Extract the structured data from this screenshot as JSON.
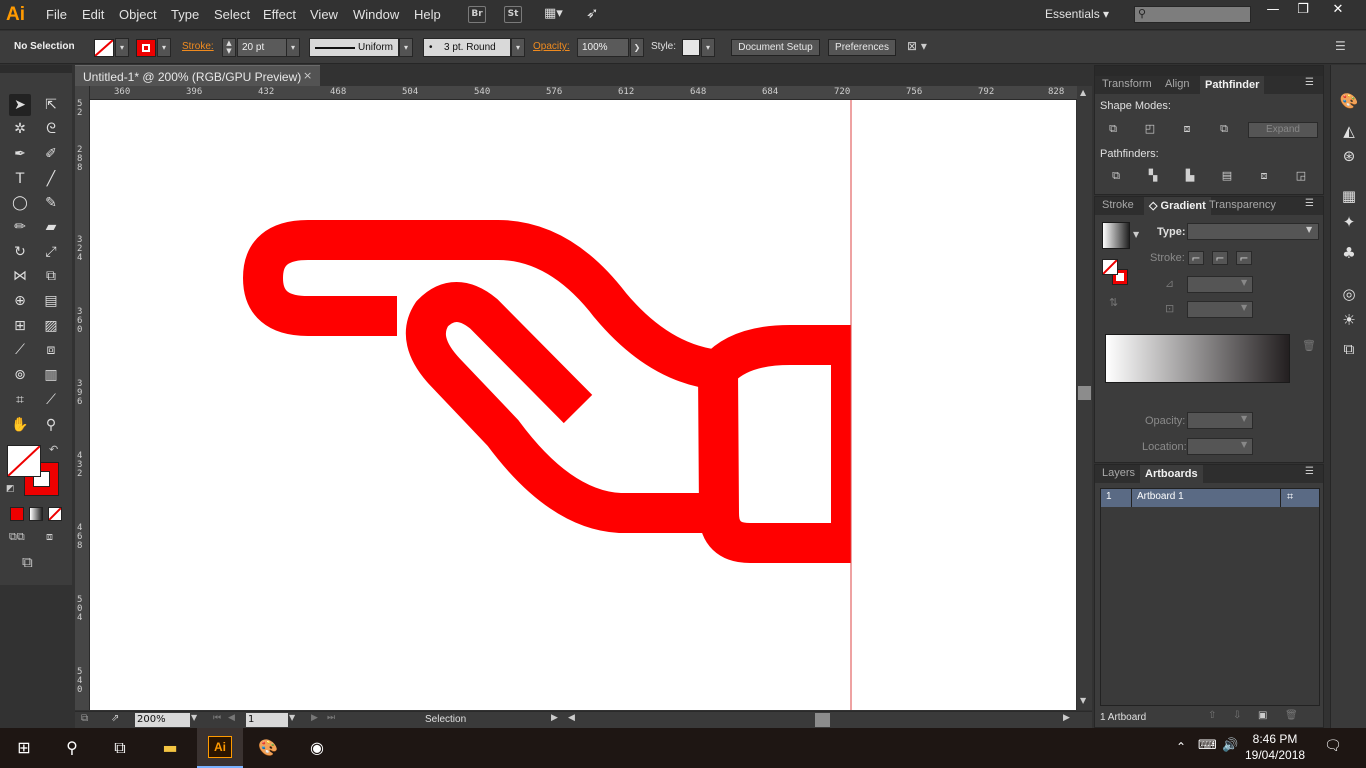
{
  "app": {
    "logo": "Ai",
    "menu": [
      "File",
      "Edit",
      "Object",
      "Type",
      "Select",
      "Effect",
      "View",
      "Window",
      "Help"
    ],
    "bridge_label": "Br",
    "stock_label": "St",
    "workspace": "Essentials",
    "window_controls": {
      "minimize": "—",
      "restore": "❐",
      "close": "✕"
    }
  },
  "control_bar": {
    "selection": "No Selection",
    "stroke_label": "Stroke:",
    "stroke_value": "20 pt",
    "profile_value": "Uniform",
    "brush_value": "3 pt. Round",
    "opacity_label": "Opacity:",
    "opacity_value": "100%",
    "style_label": "Style:",
    "document_setup": "Document Setup",
    "preferences": "Preferences"
  },
  "document": {
    "tab_title": "Untitled-1* @ 200% (RGB/GPU Preview)",
    "close": "×",
    "h_ruler_ticks": [
      "360",
      "396",
      "432",
      "468",
      "504",
      "540",
      "576",
      "612",
      "648",
      "684",
      "720",
      "756",
      "792",
      "828"
    ],
    "v_ruler_ticks": [
      "5\n2",
      "2\n8\n8",
      "3\n2\n4",
      "3\n6\n0",
      "3\n9\n6",
      "4\n3\n2",
      "4\n6\n8",
      "5\n0\n4",
      "5\n4\n0"
    ],
    "art_color": "#ff0000"
  },
  "status_bar": {
    "zoom": "200%",
    "artboard_number": "1",
    "status_text": "Selection"
  },
  "panels": {
    "top_tabs": [
      "Transform",
      "Align",
      "Pathfinder"
    ],
    "shape_modes_label": "Shape Modes:",
    "expand_label": "Expand",
    "pathfinders_label": "Pathfinders:",
    "mid_tabs": [
      "Stroke",
      "Gradient",
      "Transparency"
    ],
    "type_label": "Type:",
    "stroke_label": "Stroke:",
    "opacity_label": "Opacity:",
    "location_label": "Location:",
    "bottom_tabs": [
      "Layers",
      "Artboards"
    ],
    "artboard_rows": [
      {
        "index": "1",
        "name": "Artboard 1"
      }
    ],
    "artboard_count": "1 Artboard"
  },
  "taskbar": {
    "time": "8:46 PM",
    "date": "19/04/2018",
    "ai_label": "Ai"
  }
}
